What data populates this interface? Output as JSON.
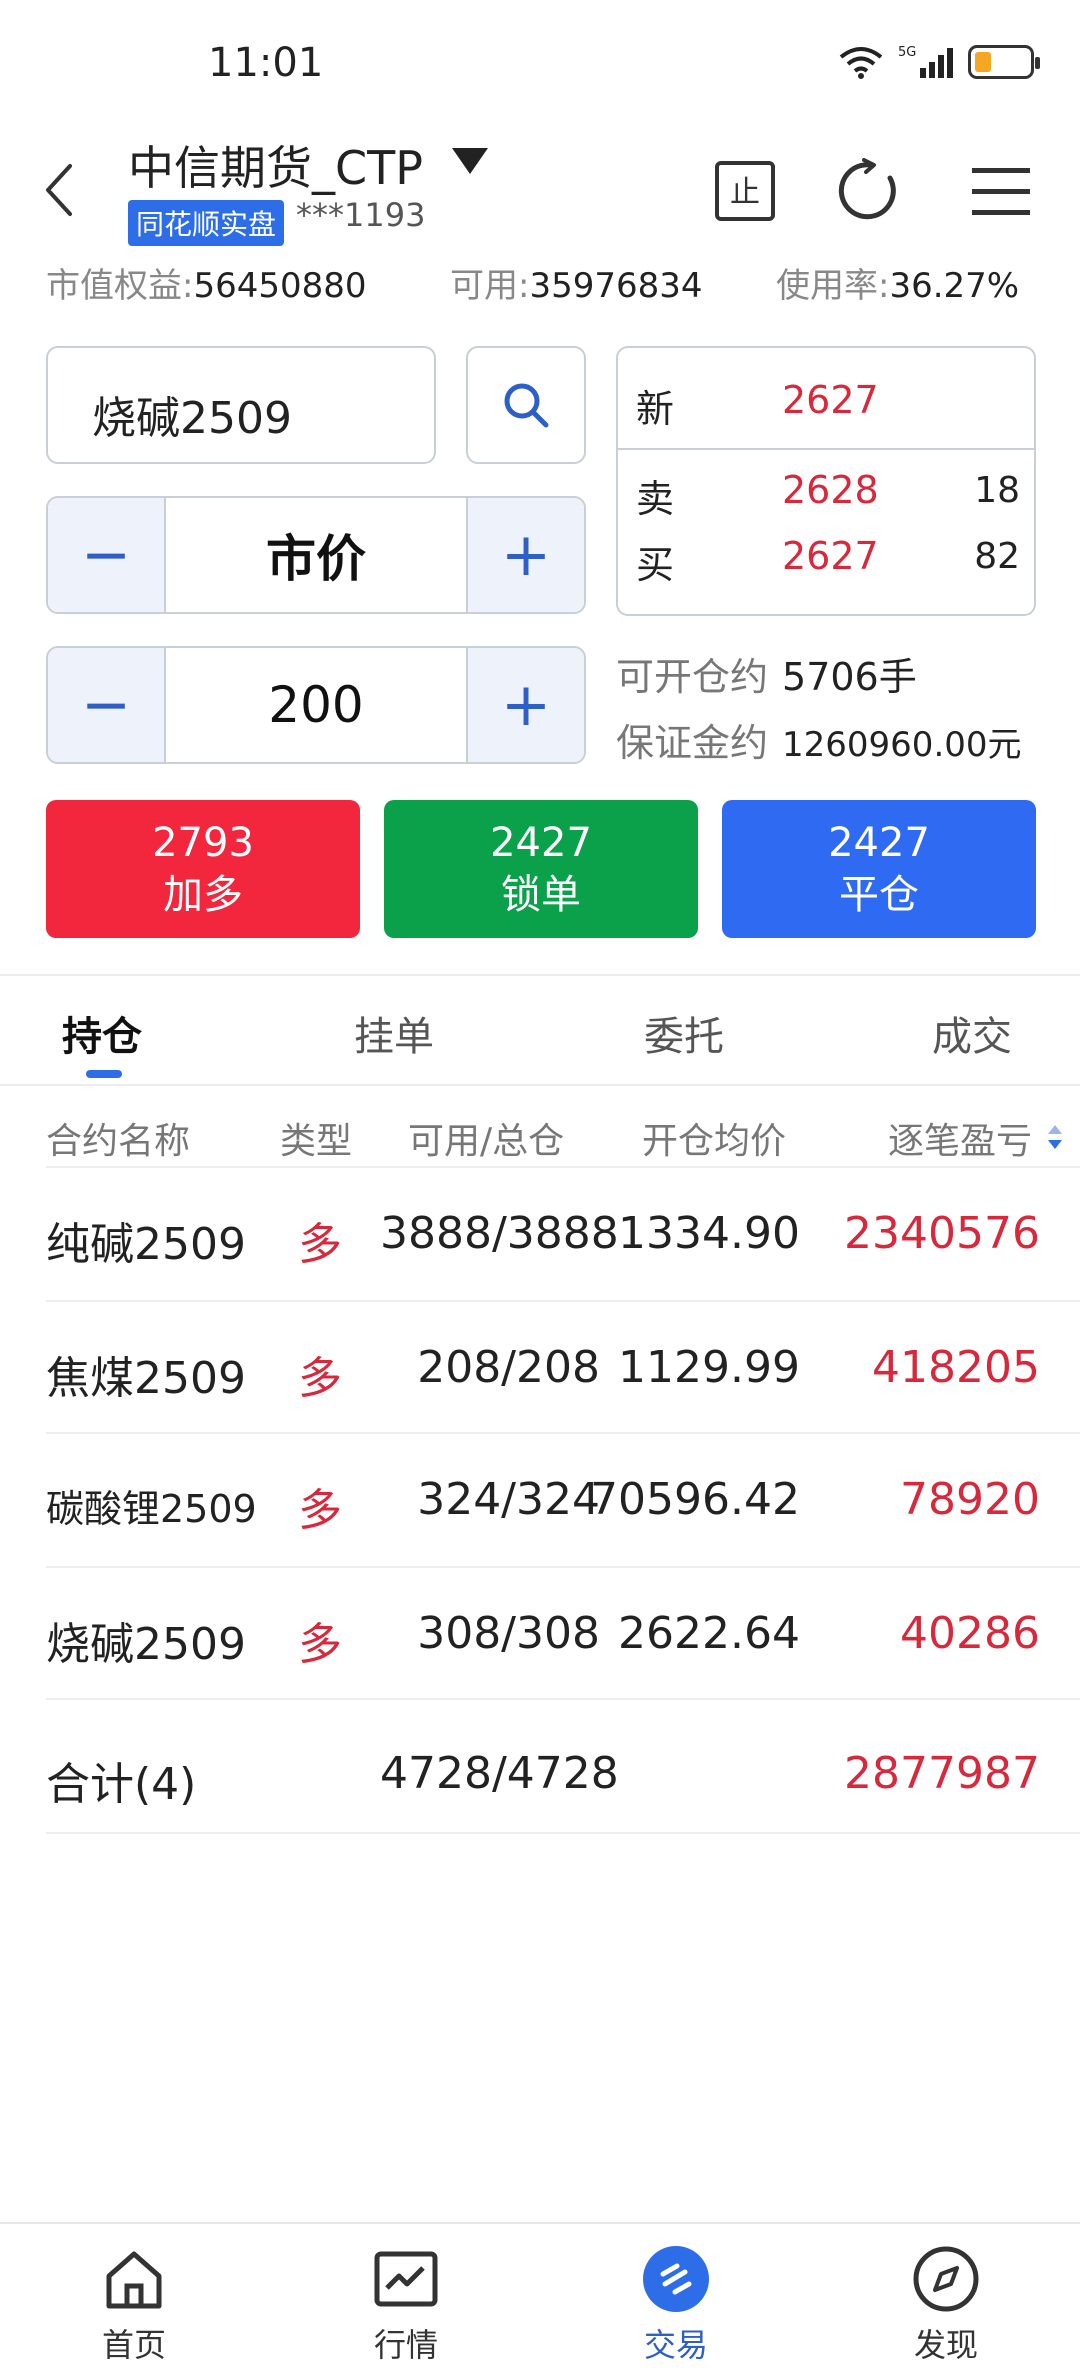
{
  "status_bar": {
    "time": "11:01",
    "network": "5G"
  },
  "header": {
    "broker": "中信期货_CTP",
    "badge": "同花顺实盘",
    "account": "***1193"
  },
  "account_summary": {
    "equity_label": "市值权益:",
    "equity_value": "56450880",
    "available_label": "可用:",
    "available_value": "35976834",
    "usage_label": "使用率:",
    "usage_value": "36.27%"
  },
  "order": {
    "symbol": "烧碱2509",
    "price_mode": "市价",
    "quantity": "200",
    "minus_symbol": "−",
    "plus_symbol": "+"
  },
  "quote": {
    "last_label": "新",
    "last_price": "2627",
    "ask_label": "卖",
    "ask_price": "2628",
    "ask_vol": "18",
    "bid_label": "买",
    "bid_price": "2627",
    "bid_vol": "82"
  },
  "capacity": {
    "open_label": "可开仓约",
    "open_value": "5706手",
    "margin_label": "保证金约",
    "margin_value": "1260960.00元"
  },
  "actions": [
    {
      "price": "2793",
      "label": "加多"
    },
    {
      "price": "2427",
      "label": "锁单"
    },
    {
      "price": "2427",
      "label": "平仓"
    }
  ],
  "tabs": [
    "持仓",
    "挂单",
    "委托",
    "成交"
  ],
  "table": {
    "headers": [
      "合约名称",
      "类型",
      "可用/总仓",
      "开仓均价",
      "逐笔盈亏"
    ],
    "rows": [
      {
        "name": "纯碱2509",
        "type": "多",
        "avail": "3888/3888",
        "avg": "1334.90",
        "pl": "2340576"
      },
      {
        "name": "焦煤2509",
        "type": "多",
        "avail": "208/208",
        "avg": "1129.99",
        "pl": "418205"
      },
      {
        "name": "碳酸锂2509",
        "type": "多",
        "avail": "324/324",
        "avg": "70596.42",
        "pl": "78920"
      },
      {
        "name": "烧碱2509",
        "type": "多",
        "avail": "308/308",
        "avg": "2622.64",
        "pl": "40286"
      }
    ],
    "total": {
      "label": "合计(4)",
      "avail": "4728/4728",
      "pl": "2877987"
    }
  },
  "nav": [
    "首页",
    "行情",
    "交易",
    "发现"
  ],
  "colors": {
    "red": "#d8283c",
    "green": "#0aa14a",
    "blue": "#2f6bf2",
    "accent": "#2d6ee8"
  },
  "icons": [
    "back-icon",
    "dropdown-icon",
    "stop-icon",
    "refresh-icon",
    "menu-icon",
    "search-icon",
    "sort-icon",
    "home-icon",
    "chart-icon",
    "trade-icon",
    "compass-icon",
    "wifi-icon",
    "signal-icon",
    "battery-icon"
  ]
}
